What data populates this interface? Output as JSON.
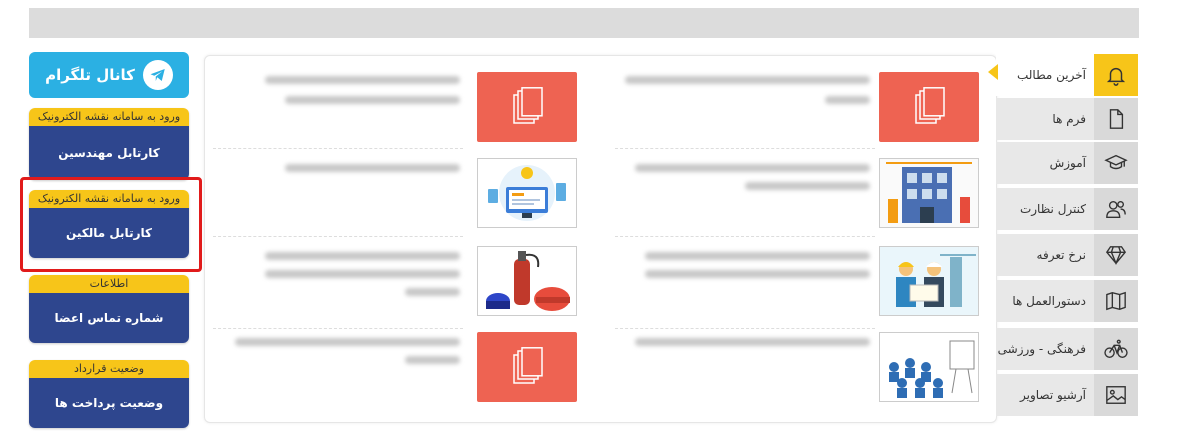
{
  "telegram": {
    "label": "کانال تلگرام"
  },
  "cards": [
    {
      "caption": "ورود به سامانه نقشه الکترونیک",
      "title": "کارتابل مهندسین"
    },
    {
      "caption": "ورود به سامانه نقشه الکترونیک",
      "title": "کارتابل مالکین"
    },
    {
      "caption": "اطلاعات",
      "title": "شماره تماس اعضا"
    },
    {
      "caption": "وضعیت قرارداد",
      "title": "وضعیت پرداخت ها"
    }
  ],
  "tabs": [
    {
      "label": "آخرین مطالب",
      "icon": "bell-icon"
    },
    {
      "label": "فرم ها",
      "icon": "document-icon"
    },
    {
      "label": "آموزش",
      "icon": "graduation-cap-icon"
    },
    {
      "label": "کنترل نظارت",
      "icon": "users-icon"
    },
    {
      "label": "نرخ تعرفه",
      "icon": "diamond-icon"
    },
    {
      "label": "دستورالعمل ها",
      "icon": "map-icon"
    },
    {
      "label": "فرهنگی - ورزشی",
      "icon": "bicycle-icon"
    },
    {
      "label": "آرشیو تصاویر",
      "icon": "image-icon"
    }
  ],
  "colors": {
    "accent": "#f7c519",
    "card": "#2e468e",
    "telegram": "#2bb0e3",
    "thumb_red": "#ee6352",
    "highlight": "#e11b1b"
  }
}
